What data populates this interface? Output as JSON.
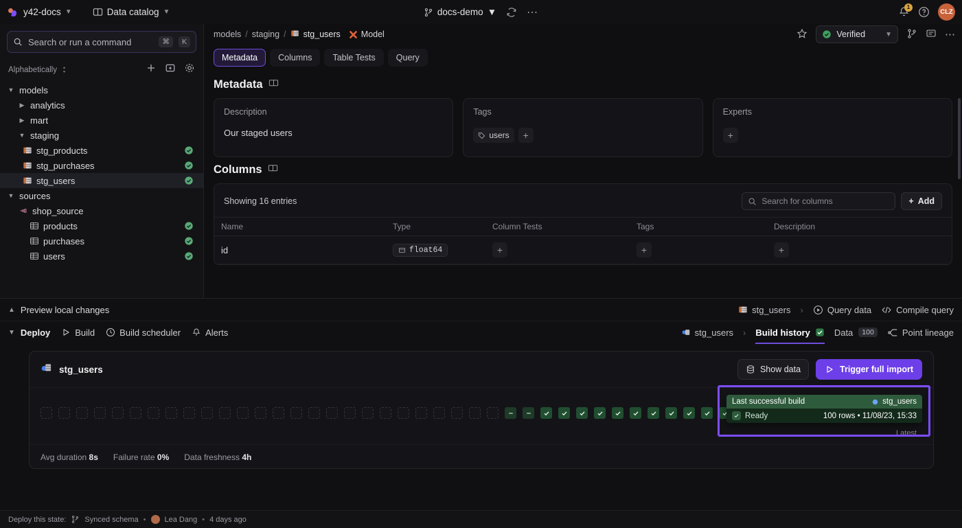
{
  "topbar": {
    "workspace": "y42-docs",
    "catalog": "Data catalog",
    "branch": "docs-demo",
    "refresh_icon": "refresh-icon",
    "more_icon": "more-horizontal-icon",
    "bell_icon": "bell-icon",
    "bell_badge": "1",
    "help_icon": "help-circle-icon",
    "avatar_initials": "CLZ"
  },
  "sidebar": {
    "search": {
      "placeholder": "Search or run a command",
      "kbd1": "⌘",
      "kbd2": "K"
    },
    "sort_label": "Alphabetically",
    "actions": [
      "plus-icon",
      "new-folder-icon",
      "gear-icon"
    ],
    "tree": [
      {
        "label": "models",
        "depth": 0,
        "caret": "down",
        "icon": "",
        "status": ""
      },
      {
        "label": "analytics",
        "depth": 1,
        "caret": "right",
        "icon": "",
        "status": ""
      },
      {
        "label": "mart",
        "depth": 1,
        "caret": "right",
        "icon": "",
        "status": ""
      },
      {
        "label": "staging",
        "depth": 1,
        "caret": "down",
        "icon": "",
        "status": ""
      },
      {
        "label": "stg_products",
        "depth": 2,
        "caret": "",
        "icon": "model-icon",
        "status": "ok"
      },
      {
        "label": "stg_purchases",
        "depth": 2,
        "caret": "",
        "icon": "model-icon",
        "status": "ok"
      },
      {
        "label": "stg_users",
        "depth": 2,
        "caret": "",
        "icon": "model-icon",
        "status": "ok",
        "selected": true
      },
      {
        "label": "sources",
        "depth": 0,
        "caret": "down",
        "icon": "",
        "status": ""
      },
      {
        "label": "shop_source",
        "depth": 1,
        "caret": "",
        "icon": "plug-icon",
        "status": ""
      },
      {
        "label": "products",
        "depth": 2,
        "caret": "",
        "icon": "table-icon",
        "status": "ok"
      },
      {
        "label": "purchases",
        "depth": 2,
        "caret": "",
        "icon": "table-icon",
        "status": "ok"
      },
      {
        "label": "users",
        "depth": 2,
        "caret": "",
        "icon": "table-icon",
        "status": "ok"
      }
    ]
  },
  "main": {
    "breadcrumb": {
      "root": "models",
      "folder": "staging",
      "asset": "stg_users",
      "type": "Model"
    },
    "star_icon": "star-icon",
    "verified_label": "Verified",
    "branch_icon": "git-branch-icon",
    "comment_icon": "comment-icon",
    "more_icon": "more-horizontal-icon",
    "tabs": [
      {
        "label": "Metadata",
        "active": true
      },
      {
        "label": "Columns",
        "active": false
      },
      {
        "label": "Table Tests",
        "active": false
      },
      {
        "label": "Query",
        "active": false
      }
    ],
    "metadata": {
      "title": "Metadata",
      "panel_icon": "panel-icon",
      "cards": [
        {
          "title": "Description",
          "value": "Our staged users"
        },
        {
          "title": "Tags",
          "tag": "users"
        },
        {
          "title": "Experts",
          "value": ""
        }
      ]
    },
    "columns": {
      "title": "Columns",
      "panel_icon": "panel-icon",
      "showing": "Showing 16 entries",
      "search_placeholder": "Search for columns",
      "add_label": "Add",
      "headers": [
        "Name",
        "Type",
        "Column Tests",
        "Tags",
        "Description"
      ],
      "rows": [
        {
          "name": "id",
          "type": "float64"
        }
      ]
    }
  },
  "bottom": {
    "preview_label": "Preview local changes",
    "preview_right": {
      "asset": "stg_users",
      "query_data": "Query data",
      "compile_query": "Compile query"
    },
    "deploy_label": "Deploy",
    "deploy_items": [
      {
        "label": "Build",
        "icon": "play-icon"
      },
      {
        "label": "Build scheduler",
        "icon": "clock-icon"
      },
      {
        "label": "Alerts",
        "icon": "bell-icon"
      }
    ],
    "sub_right": {
      "asset": "stg_users",
      "build_history": "Build history",
      "data": "Data",
      "data_badge": "100",
      "point_lineage": "Point lineage"
    },
    "build_card": {
      "title": "stg_users",
      "show_data": "Show data",
      "trigger_import": "Trigger full import",
      "latest_label": "Latest",
      "tiles": [
        "empty",
        "empty",
        "empty",
        "empty",
        "empty",
        "empty",
        "empty",
        "empty",
        "empty",
        "empty",
        "empty",
        "empty",
        "empty",
        "empty",
        "empty",
        "empty",
        "empty",
        "empty",
        "empty",
        "empty",
        "empty",
        "empty",
        "empty",
        "empty",
        "empty",
        "empty",
        "skip",
        "skip",
        "ok",
        "ok",
        "ok",
        "ok",
        "ok",
        "ok",
        "ok",
        "ok",
        "ok",
        "ok",
        "ok",
        "ok",
        "ok",
        "ok",
        "ok",
        "ok",
        "ok"
      ],
      "stats": [
        {
          "label": "Avg duration",
          "value": "8s"
        },
        {
          "label": "Failure rate",
          "value": "0%"
        },
        {
          "label": "Data freshness",
          "value": "4h"
        }
      ]
    },
    "tooltip": {
      "title": "Last successful build",
      "asset": "stg_users",
      "status": "Ready",
      "detail": "100 rows • 11/08/23, 15:33"
    }
  },
  "statusbar": {
    "prefix": "Deploy this state:",
    "schema": "Synced schema",
    "user": "Lea Dang",
    "time": "4 days ago",
    "sep": "•"
  },
  "colors": {
    "accent": "#6d3fe8",
    "highlight": "#7c4dff",
    "ok": "#4ea86a",
    "verified": "#3fa05f",
    "avatar": "#c8633b"
  }
}
